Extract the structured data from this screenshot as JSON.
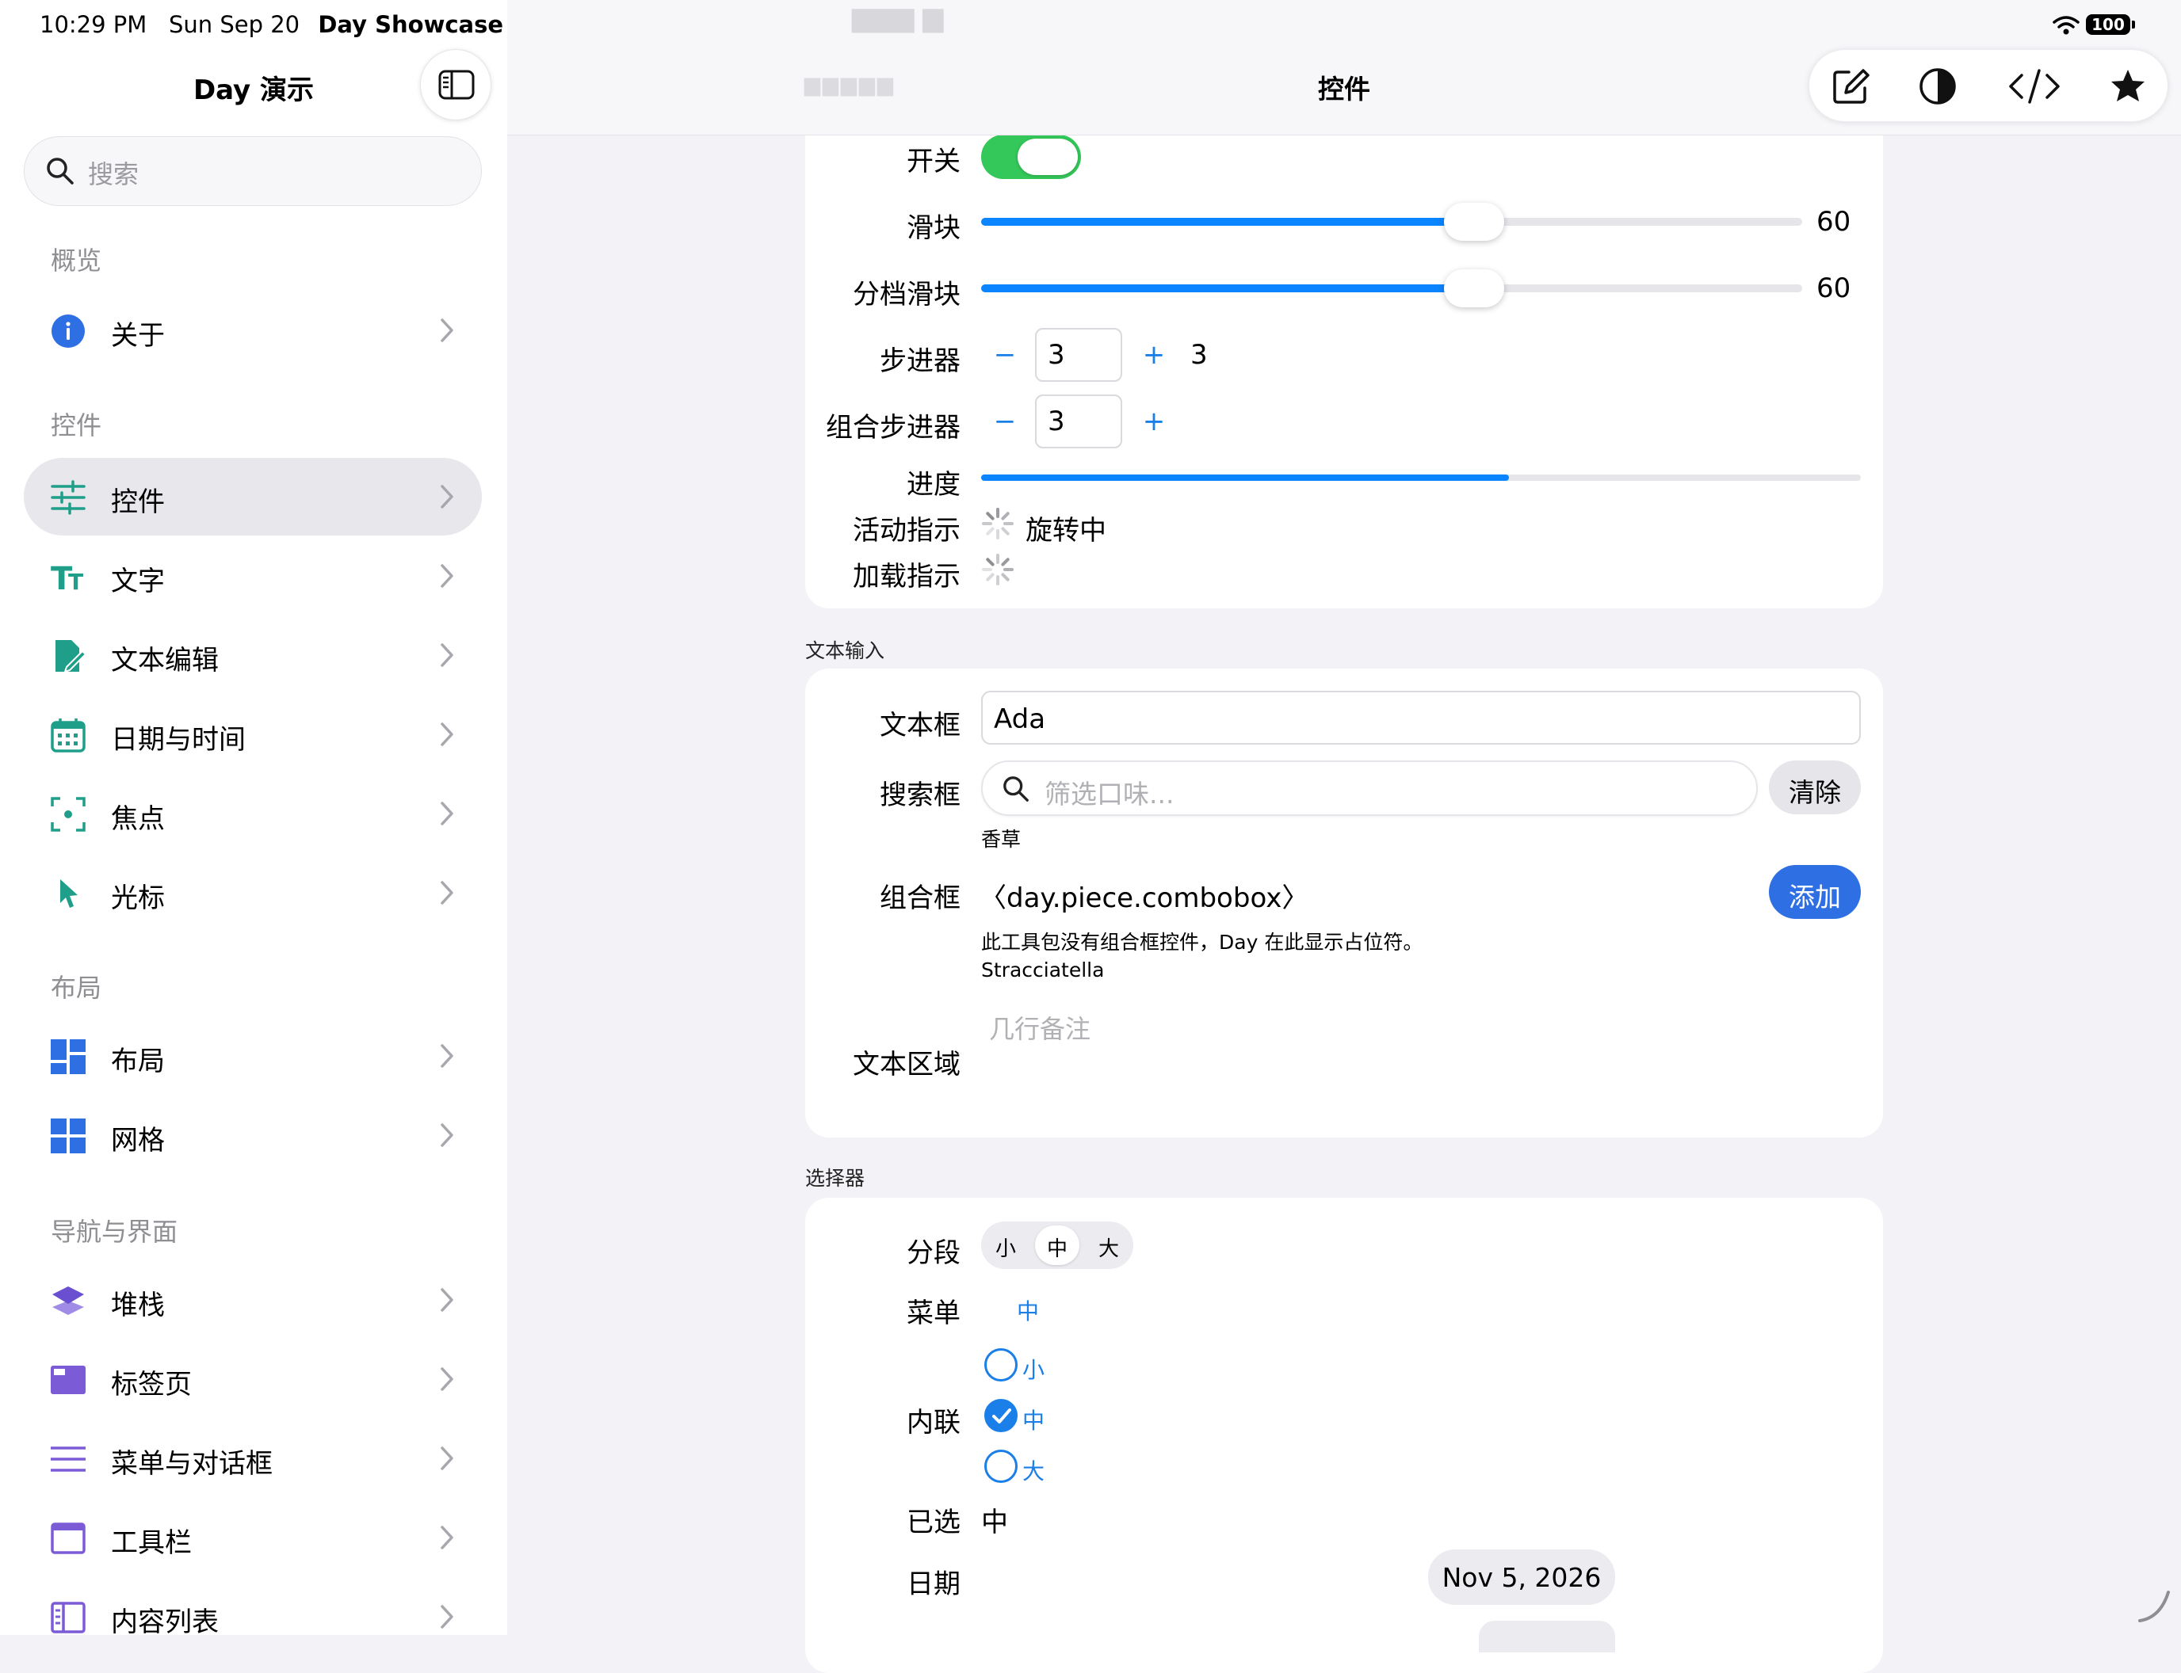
{
  "status": {
    "time": "10:29 PM",
    "date": "Sun Sep 20",
    "app": "Day Showcase",
    "battery": "100"
  },
  "sidebar": {
    "title": "Day 演示",
    "search_placeholder": "搜索",
    "sections": [
      "概览",
      "控件",
      "布局",
      "导航与界面"
    ],
    "items": [
      {
        "label": "关于",
        "icon": "info-icon"
      },
      {
        "label": "控件",
        "icon": "sliders-icon",
        "selected": true
      },
      {
        "label": "文字",
        "icon": "text-size-icon"
      },
      {
        "label": "文本编辑",
        "icon": "doc-edit-icon"
      },
      {
        "label": "日期与时间",
        "icon": "calendar-icon"
      },
      {
        "label": "焦点",
        "icon": "focus-icon"
      },
      {
        "label": "光标",
        "icon": "pointer-icon"
      },
      {
        "label": "布局",
        "icon": "layout-grid-icon"
      },
      {
        "label": "网格",
        "icon": "grid-icon"
      },
      {
        "label": "堆栈",
        "icon": "stack-icon"
      },
      {
        "label": "标签页",
        "icon": "tabs-icon"
      },
      {
        "label": "菜单与对话框",
        "icon": "menu-lines-icon"
      },
      {
        "label": "工具栏",
        "icon": "toolbar-window-icon"
      },
      {
        "label": "内容列表",
        "icon": "content-list-icon"
      }
    ]
  },
  "main": {
    "title": "控件",
    "toolbar_icons": [
      "compose-icon",
      "contrast-icon",
      "code-icon",
      "star-icon"
    ],
    "colors": {
      "accent": "#0a84ff",
      "toggle_on": "#34c759",
      "sidebar_icon": "#1f9e8a",
      "purple_icon": "#7b5bd6"
    },
    "controls": {
      "toggle": {
        "label": "开关",
        "on": true
      },
      "slider": {
        "label": "滑块",
        "value": "60",
        "fraction": 0.6
      },
      "step_slider": {
        "label": "分档滑块",
        "value": "60",
        "fraction": 0.6
      },
      "stepper": {
        "label": "步进器",
        "minus": "−",
        "plus": "+",
        "field": "3",
        "value": "3"
      },
      "combo_stepper": {
        "label": "组合步进器",
        "minus": "−",
        "plus": "+",
        "field": "3"
      },
      "progress": {
        "label": "进度",
        "fraction": 0.6
      },
      "activity": {
        "label": "活动指示",
        "text": "旋转中"
      },
      "loading": {
        "label": "加载指示"
      }
    },
    "text_input": {
      "header": "文本输入",
      "textfield": {
        "label": "文本框",
        "value": "Ada"
      },
      "searchfield": {
        "label": "搜索框",
        "placeholder": "筛选口味...",
        "clear": "清除",
        "result": "香草"
      },
      "combobox": {
        "label": "组合框",
        "value": "〈day.piece.combobox〉",
        "add": "添加",
        "note": "此工具包没有组合框控件，Day 在此显示占位符。",
        "selection": "Stracciatella"
      },
      "textarea": {
        "label": "文本区域",
        "placeholder": "几行备注"
      }
    },
    "pickers": {
      "header": "选择器",
      "segment": {
        "label": "分段",
        "options": [
          "小",
          "中",
          "大"
        ],
        "selected": "中"
      },
      "menu": {
        "label": "菜单",
        "value": "中"
      },
      "inline": {
        "label": "内联",
        "options": [
          "小",
          "中",
          "大"
        ],
        "selected": "中"
      },
      "chosen": {
        "label": "已选",
        "value": "中"
      },
      "date": {
        "label": "日期",
        "value": "Nov 5, 2026"
      }
    }
  }
}
